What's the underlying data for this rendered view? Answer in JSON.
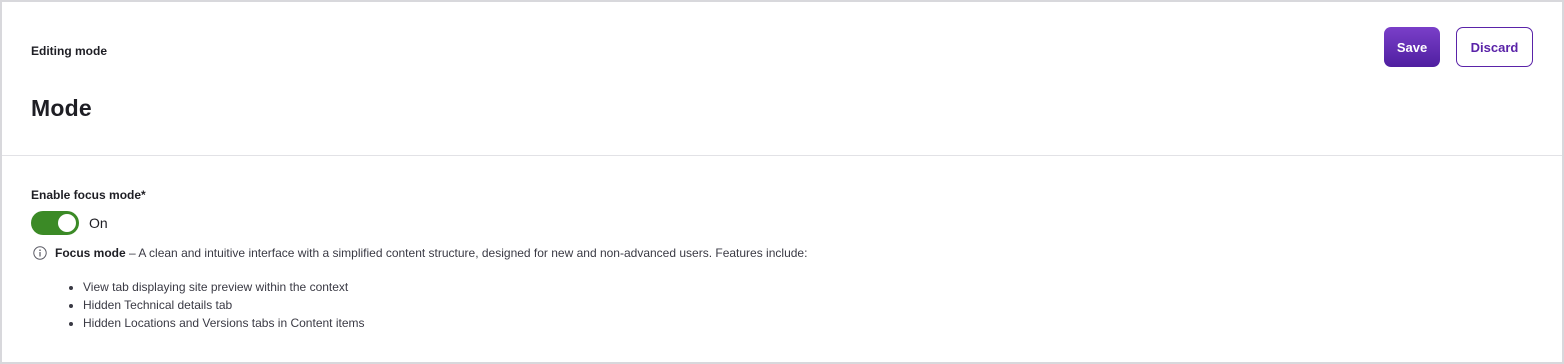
{
  "header": {
    "subtitle": "Editing mode",
    "title": "Mode",
    "save_label": "Save",
    "discard_label": "Discard"
  },
  "form": {
    "field_label": "Enable focus mode*",
    "toggle_state": "On",
    "toggle_on": true,
    "info_icon": "info-icon",
    "info_title": "Focus mode",
    "info_text": " – A clean and intuitive interface with a simplified content structure, designed for new and non-advanced users. Features include:",
    "features": [
      "View tab displaying site preview within the context",
      "Hidden Technical details tab",
      "Hidden Locations and Versions tabs in Content items"
    ]
  },
  "colors": {
    "accent": "#5a23a8",
    "toggle_on": "#3b8a26"
  }
}
